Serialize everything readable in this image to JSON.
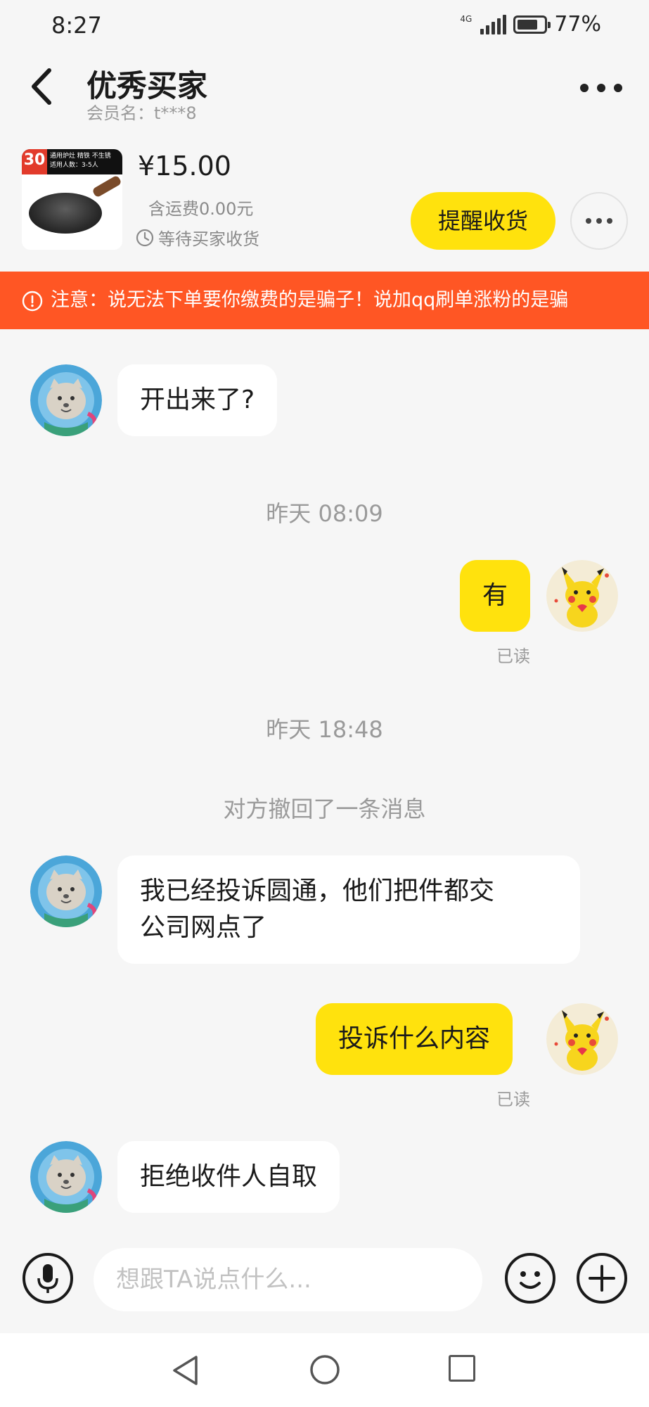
{
  "status_bar": {
    "time": "8:27",
    "network": "4G",
    "battery": "77%",
    "battery_level": 0.77
  },
  "header": {
    "title": "优秀买家",
    "member_label": "会员名：t***8"
  },
  "product": {
    "thumb_badge": "30",
    "thumb_text_line1": "通用炉灶  精铁  不生锈",
    "thumb_text_line2": "适用人数：3-5人",
    "price": "¥15.00",
    "shipping": "含运费0.00元",
    "status": "等待买家收货",
    "remind_button": "提醒收货"
  },
  "notice": {
    "text": "注意：说无法下单要你缴费的是骗子！说加qq刷单涨粉的是骗"
  },
  "messages": {
    "m1": {
      "text": "开出来了?"
    },
    "t1": {
      "text": "昨天 08:09"
    },
    "m2": {
      "text": "有",
      "status": "已读"
    },
    "t2": {
      "text": "昨天 18:48"
    },
    "recall": {
      "text": "对方撤回了一条消息"
    },
    "m3": {
      "line1": "我已经投诉圆通，他们把件都交",
      "line2": "公司网点了"
    },
    "m4": {
      "text": "投诉什么内容",
      "status": "已读"
    },
    "m5": {
      "text": "拒绝收件人自取"
    }
  },
  "input": {
    "placeholder": "想跟TA说点什么..."
  },
  "colors": {
    "accent": "#ffe20d",
    "notice": "#ff5624",
    "background": "#f6f6f6"
  },
  "icons": {
    "back": "back-arrow-icon",
    "more": "more-icon",
    "clock": "clock-icon",
    "alert": "alert-icon",
    "mic": "microphone-icon",
    "emoji": "emoji-icon",
    "plus": "plus-icon",
    "nav_back": "nav-back-icon",
    "nav_home": "nav-home-icon",
    "nav_recent": "nav-recent-icon"
  }
}
